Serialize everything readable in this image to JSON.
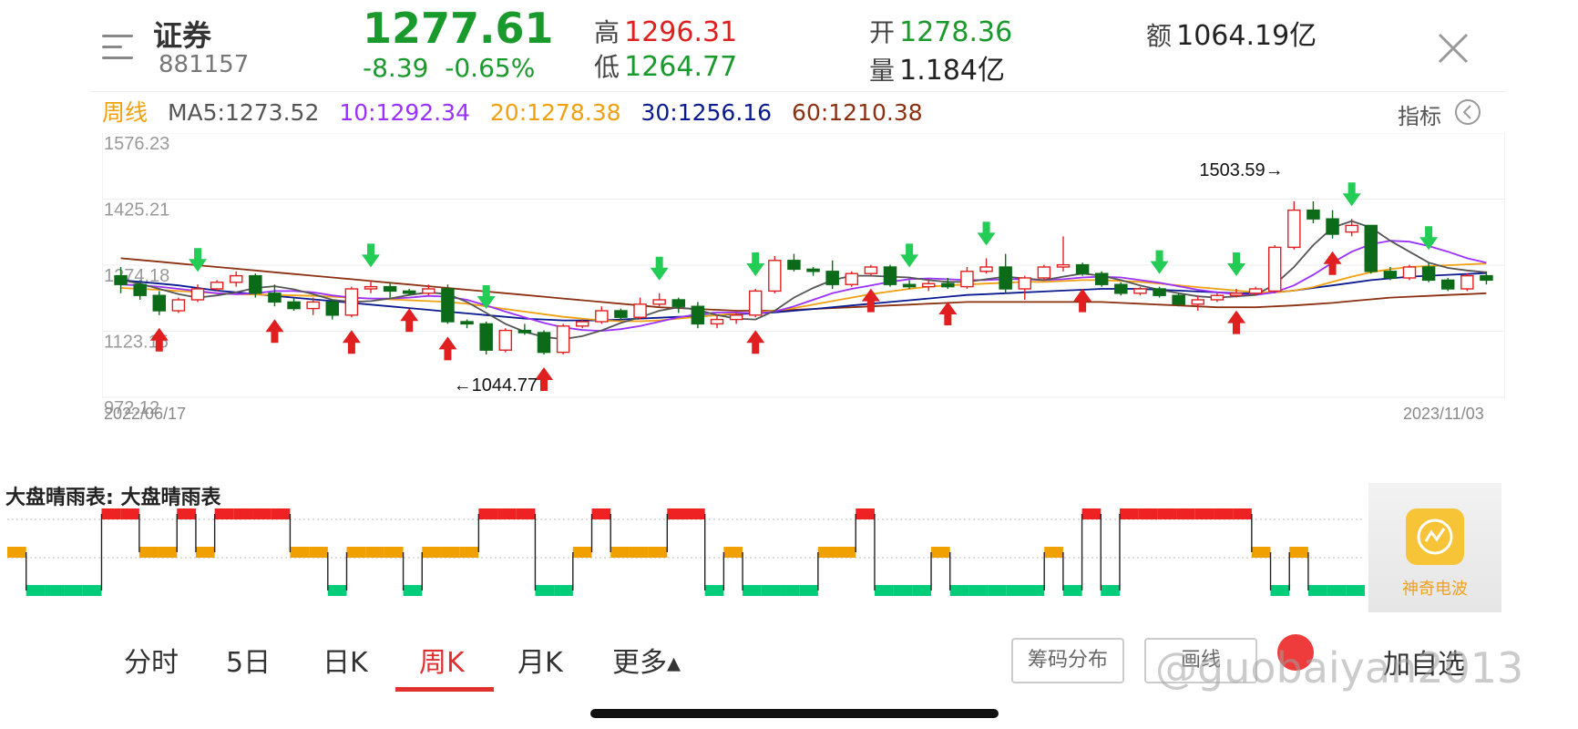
{
  "header": {
    "name": "证券",
    "code": "881157",
    "price": "1277.61",
    "change": "-8.39",
    "change_pct": "-0.65%",
    "high_label": "高",
    "high": "1296.31",
    "low_label": "低",
    "low": "1264.77",
    "open_label": "开",
    "open": "1278.36",
    "volume_label": "量",
    "volume": "1.184亿",
    "amount_label": "额",
    "amount": "1064.19亿"
  },
  "ma_row": {
    "period": "周线",
    "ma5": "MA5:1273.52",
    "ma10": "10:1292.34",
    "ma20": "20:1278.38",
    "ma30": "30:1256.16",
    "ma60": "60:1210.38",
    "indicator_btn": "指标"
  },
  "chart_data": {
    "type": "candlestick",
    "y_axis_labels": [
      "1576.23",
      "1425.21",
      "1274.18",
      "1123.15",
      "972.12"
    ],
    "ylim": [
      972.12,
      1576.23
    ],
    "x_labels": [
      "2022/06/17",
      "2023/11/03"
    ],
    "annotations": {
      "max": "1503.59→",
      "min": "←1044.77"
    },
    "candles": [
      [
        1250,
        1270,
        1210,
        1230
      ],
      [
        1230,
        1240,
        1195,
        1205
      ],
      [
        1205,
        1215,
        1160,
        1170
      ],
      [
        1170,
        1200,
        1165,
        1195
      ],
      [
        1195,
        1230,
        1190,
        1220
      ],
      [
        1220,
        1240,
        1215,
        1235
      ],
      [
        1235,
        1260,
        1225,
        1250
      ],
      [
        1250,
        1255,
        1200,
        1210
      ],
      [
        1210,
        1230,
        1180,
        1190
      ],
      [
        1190,
        1200,
        1170,
        1175
      ],
      [
        1175,
        1200,
        1160,
        1190
      ],
      [
        1190,
        1195,
        1150,
        1160
      ],
      [
        1160,
        1225,
        1155,
        1220
      ],
      [
        1220,
        1240,
        1210,
        1225
      ],
      [
        1225,
        1235,
        1200,
        1215
      ],
      [
        1215,
        1220,
        1205,
        1210
      ],
      [
        1210,
        1230,
        1205,
        1220
      ],
      [
        1220,
        1230,
        1140,
        1145
      ],
      [
        1145,
        1150,
        1130,
        1140
      ],
      [
        1140,
        1145,
        1070,
        1080
      ],
      [
        1080,
        1130,
        1075,
        1125
      ],
      [
        1125,
        1140,
        1115,
        1120
      ],
      [
        1120,
        1125,
        1070,
        1075
      ],
      [
        1075,
        1140,
        1070,
        1135
      ],
      [
        1135,
        1150,
        1130,
        1145
      ],
      [
        1145,
        1180,
        1140,
        1170
      ],
      [
        1170,
        1175,
        1150,
        1155
      ],
      [
        1155,
        1200,
        1150,
        1185
      ],
      [
        1185,
        1210,
        1180,
        1195
      ],
      [
        1195,
        1200,
        1165,
        1180
      ],
      [
        1180,
        1190,
        1130,
        1140
      ],
      [
        1140,
        1160,
        1130,
        1150
      ],
      [
        1150,
        1165,
        1140,
        1160
      ],
      [
        1160,
        1220,
        1155,
        1215
      ],
      [
        1215,
        1295,
        1210,
        1285
      ],
      [
        1285,
        1300,
        1260,
        1265
      ],
      [
        1265,
        1270,
        1250,
        1260
      ],
      [
        1260,
        1285,
        1220,
        1230
      ],
      [
        1230,
        1260,
        1225,
        1255
      ],
      [
        1255,
        1275,
        1250,
        1270
      ],
      [
        1270,
        1275,
        1225,
        1230
      ],
      [
        1230,
        1240,
        1220,
        1225
      ],
      [
        1225,
        1240,
        1215,
        1232
      ],
      [
        1232,
        1245,
        1220,
        1225
      ],
      [
        1225,
        1270,
        1220,
        1260
      ],
      [
        1260,
        1290,
        1255,
        1270
      ],
      [
        1270,
        1300,
        1210,
        1220
      ],
      [
        1220,
        1250,
        1195,
        1245
      ],
      [
        1245,
        1275,
        1240,
        1270
      ],
      [
        1270,
        1340,
        1260,
        1275
      ],
      [
        1275,
        1280,
        1250,
        1255
      ],
      [
        1255,
        1260,
        1225,
        1230
      ],
      [
        1230,
        1235,
        1205,
        1210
      ],
      [
        1210,
        1225,
        1205,
        1220
      ],
      [
        1220,
        1225,
        1200,
        1205
      ],
      [
        1205,
        1210,
        1180,
        1185
      ],
      [
        1185,
        1205,
        1170,
        1195
      ],
      [
        1195,
        1210,
        1190,
        1205
      ],
      [
        1205,
        1220,
        1200,
        1210
      ],
      [
        1210,
        1225,
        1205,
        1220
      ],
      [
        1215,
        1320,
        1210,
        1315
      ],
      [
        1315,
        1420,
        1310,
        1400
      ],
      [
        1400,
        1420,
        1370,
        1380
      ],
      [
        1380,
        1400,
        1335,
        1345
      ],
      [
        1350,
        1380,
        1340,
        1365
      ],
      [
        1365,
        1365,
        1255,
        1260
      ],
      [
        1260,
        1270,
        1240,
        1245
      ],
      [
        1245,
        1275,
        1240,
        1270
      ],
      [
        1270,
        1280,
        1235,
        1240
      ],
      [
        1240,
        1245,
        1215,
        1220
      ],
      [
        1220,
        1255,
        1215,
        1250
      ],
      [
        1250,
        1260,
        1230,
        1240
      ]
    ],
    "ma": {
      "ma5": [
        1240,
        1232,
        1220,
        1208,
        1200,
        1205,
        1212,
        1222,
        1226,
        1219,
        1208,
        1195,
        1190,
        1192,
        1198,
        1206,
        1212,
        1208,
        1190,
        1165,
        1140,
        1122,
        1110,
        1105,
        1112,
        1125,
        1142,
        1155,
        1170,
        1178,
        1172,
        1160,
        1152,
        1150,
        1170,
        1200,
        1222,
        1240,
        1250,
        1250,
        1248,
        1246,
        1240,
        1236,
        1236,
        1242,
        1248,
        1244,
        1240,
        1248,
        1255,
        1250,
        1240,
        1228,
        1218,
        1210,
        1203,
        1200,
        1203,
        1206,
        1230,
        1270,
        1320,
        1360,
        1375,
        1360,
        1330,
        1305,
        1280,
        1268,
        1262,
        1258
      ],
      "ma10": [
        1230,
        1228,
        1225,
        1220,
        1215,
        1210,
        1208,
        1210,
        1215,
        1215,
        1212,
        1205,
        1200,
        1198,
        1198,
        1200,
        1204,
        1202,
        1195,
        1182,
        1168,
        1155,
        1142,
        1132,
        1126,
        1124,
        1128,
        1135,
        1145,
        1155,
        1162,
        1166,
        1166,
        1164,
        1168,
        1180,
        1195,
        1210,
        1220,
        1228,
        1236,
        1242,
        1244,
        1242,
        1240,
        1240,
        1242,
        1242,
        1240,
        1242,
        1246,
        1248,
        1246,
        1240,
        1234,
        1226,
        1218,
        1212,
        1208,
        1206,
        1212,
        1228,
        1252,
        1280,
        1305,
        1322,
        1330,
        1328,
        1318,
        1305,
        1290,
        1280
      ],
      "ma20": [
        1222,
        1220,
        1218,
        1215,
        1213,
        1210,
        1208,
        1207,
        1206,
        1205,
        1204,
        1202,
        1200,
        1198,
        1196,
        1194,
        1192,
        1190,
        1186,
        1180,
        1174,
        1168,
        1162,
        1156,
        1152,
        1148,
        1146,
        1146,
        1148,
        1152,
        1156,
        1160,
        1164,
        1166,
        1170,
        1176,
        1184,
        1192,
        1200,
        1208,
        1214,
        1220,
        1225,
        1228,
        1230,
        1232,
        1234,
        1236,
        1236,
        1238,
        1240,
        1240,
        1238,
        1236,
        1232,
        1228,
        1224,
        1220,
        1216,
        1212,
        1212,
        1216,
        1224,
        1236,
        1248,
        1258,
        1265,
        1270,
        1272,
        1274,
        1276,
        1278
      ],
      "ma30": [
        1240,
        1236,
        1232,
        1228,
        1222,
        1216,
        1212,
        1208,
        1204,
        1200,
        1196,
        1192,
        1188,
        1184,
        1180,
        1176,
        1172,
        1168,
        1164,
        1160,
        1156,
        1152,
        1150,
        1148,
        1148,
        1148,
        1150,
        1152,
        1154,
        1156,
        1158,
        1160,
        1162,
        1164,
        1166,
        1170,
        1174,
        1178,
        1182,
        1186,
        1190,
        1194,
        1198,
        1202,
        1206,
        1208,
        1210,
        1212,
        1214,
        1216,
        1218,
        1220,
        1220,
        1220,
        1218,
        1216,
        1214,
        1212,
        1210,
        1210,
        1212,
        1216,
        1222,
        1228,
        1234,
        1240,
        1244,
        1248,
        1250,
        1252,
        1254,
        1256
      ],
      "ma60": [
        1290,
        1286,
        1282,
        1278,
        1274,
        1270,
        1266,
        1262,
        1258,
        1254,
        1250,
        1246,
        1242,
        1238,
        1234,
        1230,
        1226,
        1222,
        1218,
        1214,
        1210,
        1206,
        1202,
        1198,
        1194,
        1190,
        1186,
        1182,
        1178,
        1176,
        1174,
        1172,
        1170,
        1170,
        1170,
        1172,
        1174,
        1176,
        1178,
        1180,
        1182,
        1184,
        1186,
        1188,
        1190,
        1190,
        1190,
        1190,
        1190,
        1190,
        1190,
        1190,
        1188,
        1186,
        1184,
        1182,
        1180,
        1178,
        1178,
        1178,
        1180,
        1182,
        1185,
        1188,
        1192,
        1196,
        1200,
        1202,
        1204,
        1206,
        1208,
        1210
      ]
    },
    "signals_up": [
      2,
      8,
      12,
      15,
      17,
      22,
      33,
      39,
      43,
      50,
      58,
      63
    ],
    "signals_down": [
      4,
      13,
      19,
      28,
      33,
      41,
      45,
      54,
      58,
      64,
      68
    ]
  },
  "indicator": {
    "label": "大盘晴雨表: 大盘晴雨表",
    "states": [
      1,
      0,
      0,
      0,
      0,
      2,
      2,
      1,
      1,
      2,
      1,
      2,
      2,
      2,
      2,
      1,
      1,
      0,
      1,
      1,
      1,
      0,
      1,
      1,
      1,
      2,
      2,
      2,
      0,
      0,
      1,
      2,
      1,
      1,
      1,
      2,
      2,
      0,
      1,
      0,
      0,
      0,
      0,
      1,
      1,
      2,
      0,
      0,
      0,
      1,
      0,
      0,
      0,
      0,
      0,
      1,
      0,
      2,
      0,
      2,
      2,
      2,
      2,
      2,
      2,
      2,
      1,
      0,
      1,
      0,
      0,
      0
    ],
    "wave_btn": "神奇电波"
  },
  "tabs": [
    {
      "label": "分时"
    },
    {
      "label": "5日"
    },
    {
      "label": "日K"
    },
    {
      "label": "周K"
    },
    {
      "label": "月K"
    },
    {
      "label": "更多▴"
    }
  ],
  "actions": {
    "chip": "筹码分布",
    "draw": "画线",
    "add": "加自选"
  },
  "watermark": "@guobaiyan2013",
  "colors": {
    "up": "#e02020",
    "down": "#0b6b18",
    "ma5": "#555555",
    "ma10": "#9b30ff",
    "ma20": "#f0a010",
    "ma30": "#0a1a90",
    "ma60": "#8b3010"
  }
}
